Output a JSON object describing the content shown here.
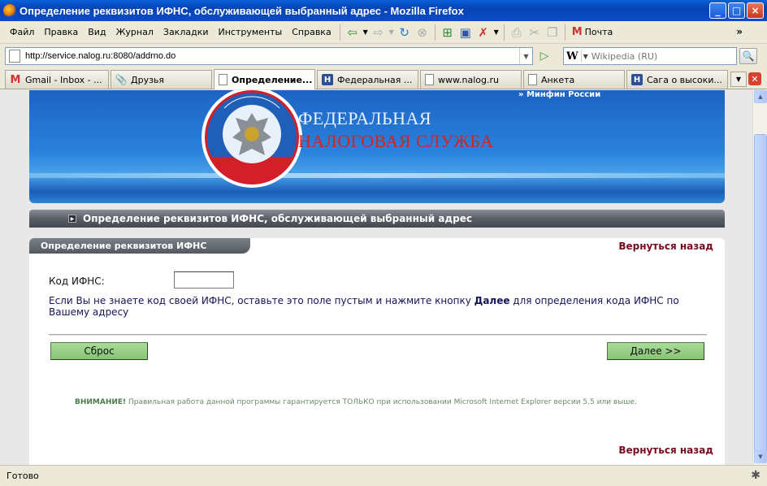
{
  "window": {
    "title": "Определение реквизитов ИФНС, обслуживающей выбранный адрес - Mozilla Firefox",
    "min": "_",
    "max": "□",
    "close": "×"
  },
  "menu": {
    "items": [
      "Файл",
      "Правка",
      "Вид",
      "Журнал",
      "Закладки",
      "Инструменты",
      "Справка"
    ],
    "mail_label": "Почта",
    "overflow": "»"
  },
  "nav": {
    "url": "http://service.nalog.ru:8080/addrno.do",
    "search_placeholder": "Wikipedia (RU)",
    "search_engine_letter": "W"
  },
  "tabs": [
    {
      "label": "Gmail - Inbox - ...",
      "icon": "gmail-icon"
    },
    {
      "label": "Друзья",
      "icon": "paperclip-icon"
    },
    {
      "label": "Определение...",
      "icon": "page-icon"
    },
    {
      "label": "Федеральная ...",
      "icon": "h-icon"
    },
    {
      "label": "www.nalog.ru",
      "icon": "page-icon"
    },
    {
      "label": "Анкета",
      "icon": "page-icon"
    },
    {
      "label": "Сага о высоки...",
      "icon": "h-icon"
    }
  ],
  "banner": {
    "minfin": "» Минфин России",
    "line1": "ФЕДЕРАЛЬНАЯ",
    "line2": "НАЛОГОВАЯ СЛУЖБА",
    "emblem_text": "ФЕДЕРАЛЬНАЯ НАЛОГОВАЯ СЛУЖБА"
  },
  "page": {
    "nav_title": "Определение реквизитов ИФНС, обслуживающей выбранный адрес",
    "panel_title": "Определение реквизитов ИФНС",
    "back": "Вернуться назад",
    "code_label": "Код ИФНС:",
    "code_value": "",
    "hint_before": "Если Вы не знаете код своей ИФНС, оставьте это поле пустым и нажмите кнопку ",
    "hint_bold": "Далее",
    "hint_after": " для определения кода ИФНС по Вашему адресу",
    "reset": "Сброс",
    "next": "Далее >>",
    "warning_bold": "ВНИМАНИЕ!",
    "warning_text": " Правильная работа данной программы гарантируется ТОЛЬКО при использовании Microsoft Internet Explorer версии 5.5 или выше."
  },
  "status": {
    "text": "Готово"
  },
  "colors": {
    "title_bar": "#0a4cc4",
    "banner_blue": "#2a82dd",
    "button_green": "#87c474",
    "back_link": "#7a0b1f",
    "banner_red": "#d4241e"
  }
}
